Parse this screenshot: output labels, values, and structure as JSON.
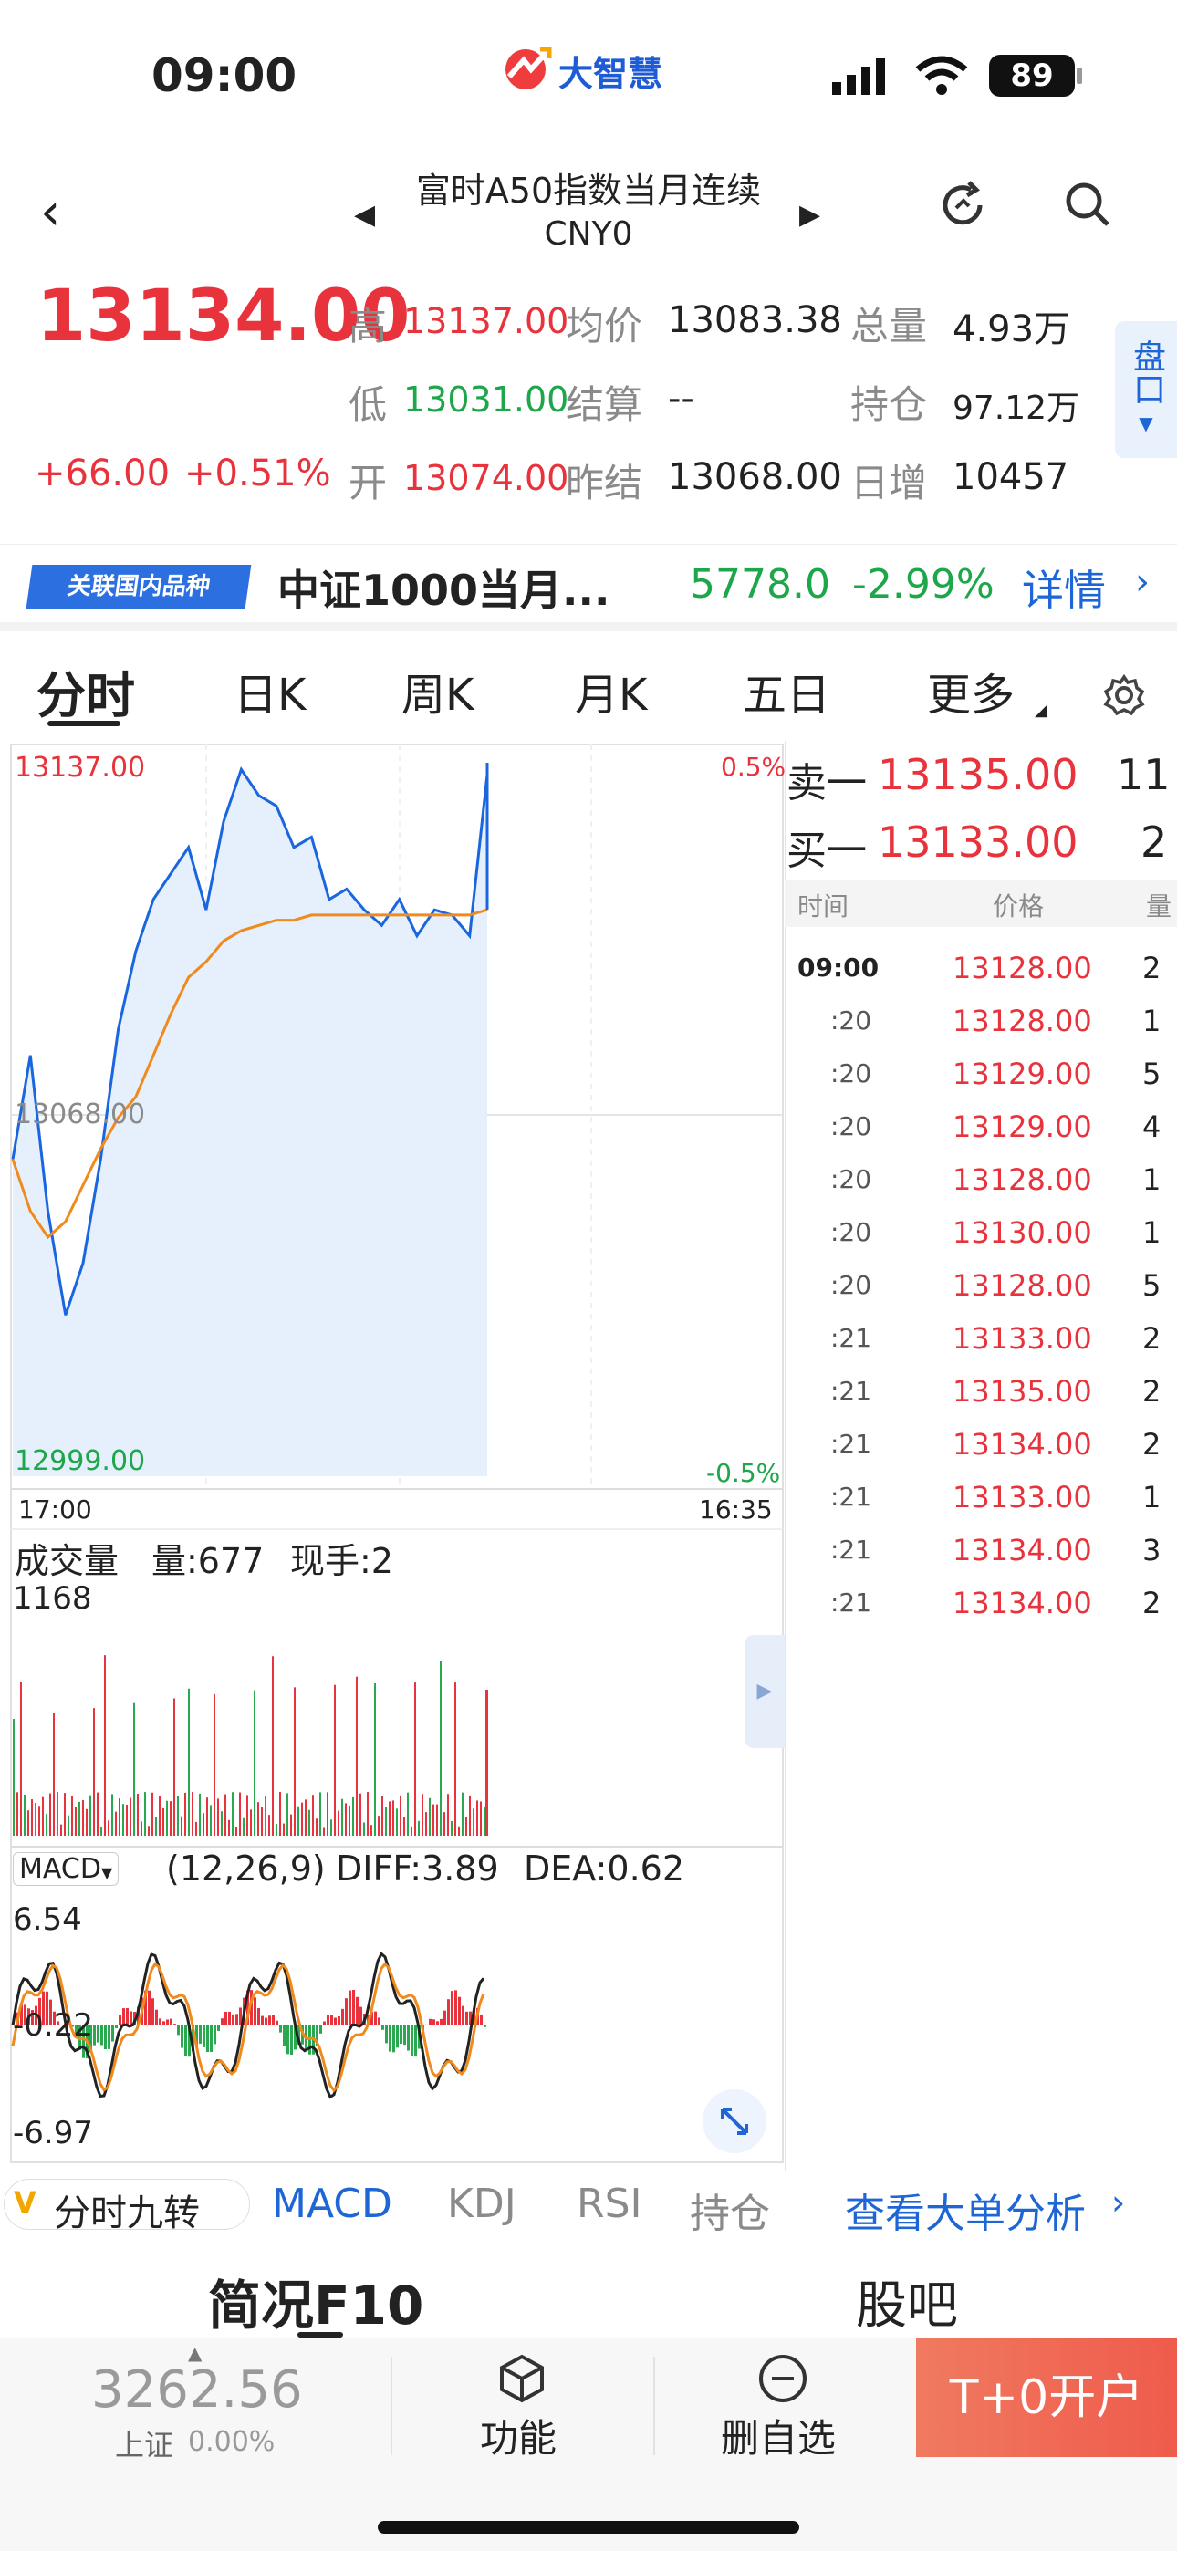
{
  "status": {
    "time": "09:00",
    "app_logo": "大智慧",
    "battery": "89"
  },
  "nav": {
    "title": "富时A50指数当月连续",
    "code": "CNY0"
  },
  "quote": {
    "price": "13134.00",
    "change": "+66.00",
    "change_pct": "+0.51%",
    "high_label": "高",
    "high": "13137.00",
    "avg_label": "均价",
    "avg": "13083.38",
    "vol_label": "总量",
    "vol": "4.93万",
    "low_label": "低",
    "low": "13031.00",
    "settle_label": "结算",
    "settle": "--",
    "oi_label": "持仓",
    "oi": "97.12万",
    "open_label": "开",
    "open": "13074.00",
    "prev_label": "昨结",
    "prev": "13068.00",
    "inc_label": "日增",
    "inc": "10457",
    "side_label": "盘口"
  },
  "related": {
    "tag": "关联国内品种",
    "name": "中证1000当月...",
    "price": "5778.0",
    "pct": "-2.99%",
    "detail": "详情"
  },
  "tabs": [
    "分时",
    "日K",
    "周K",
    "月K",
    "五日",
    "更多"
  ],
  "chart": {
    "top_price": "13137.00",
    "top_pct": "0.5%",
    "mid_price": "13068.00",
    "bottom_price": "12999.00",
    "bottom_pct": "-0.5%",
    "time_start": "17:00",
    "time_end": "16:35",
    "vol_title": "成交量",
    "vol_info": "量:677",
    "vol_hand": "现手:2",
    "vol_max": "1168",
    "macd_label": "MACD",
    "macd_params": "(12,26,9)",
    "diff": "DIFF:3.89",
    "dea": "DEA:0.62",
    "macd_max": "6.54",
    "macd_mid": "-0.22",
    "macd_min": "-6.97"
  },
  "chart_data": {
    "type": "line",
    "series": [
      {
        "values": [
          13060,
          13080,
          13050,
          13030,
          13040,
          13060,
          13085,
          13100,
          13110,
          13115,
          13120,
          13108,
          13125,
          13135,
          13130,
          13128,
          13120,
          13122,
          13110,
          13112,
          13108,
          13105,
          13110,
          13103,
          13108,
          13107,
          13103,
          13134
        ]
      },
      {
        "values": [
          13060,
          13050,
          13045,
          13048,
          13055,
          13062,
          13068,
          13072,
          13080,
          13088,
          13095,
          13098,
          13102,
          13104,
          13105,
          13106,
          13106,
          13107,
          13107,
          13107,
          13107,
          13107,
          13107,
          13107,
          13107,
          13107,
          13107,
          13108
        ]
      }
    ],
    "ylim": [
      12999,
      13137
    ]
  },
  "orderbook": {
    "sell_label": "卖一",
    "sell_price": "13135.00",
    "sell_qty": "11",
    "buy_label": "买一",
    "buy_price": "13133.00",
    "buy_qty": "2",
    "head_time": "时间",
    "head_price": "价格",
    "head_qty": "量",
    "ticks": [
      [
        "09:00",
        "13128.00",
        "2"
      ],
      [
        ":20",
        "13128.00",
        "1"
      ],
      [
        ":20",
        "13129.00",
        "5"
      ],
      [
        ":20",
        "13129.00",
        "4"
      ],
      [
        ":20",
        "13128.00",
        "1"
      ],
      [
        ":20",
        "13130.00",
        "1"
      ],
      [
        ":20",
        "13128.00",
        "5"
      ],
      [
        ":21",
        "13133.00",
        "2"
      ],
      [
        ":21",
        "13135.00",
        "2"
      ],
      [
        ":21",
        "13134.00",
        "2"
      ],
      [
        ":21",
        "13133.00",
        "1"
      ],
      [
        ":21",
        "13134.00",
        "3"
      ],
      [
        ":21",
        "13134.00",
        "2"
      ]
    ]
  },
  "indicators": {
    "nine": "分时九转",
    "items": [
      "MACD",
      "KDJ",
      "RSI",
      "持仓"
    ],
    "big_order": "查看大单分析"
  },
  "sub_tabs": {
    "f10": "简况F10",
    "bar": "股吧"
  },
  "bottom": {
    "index_value": "3262.56",
    "index_name": "上证",
    "index_pct": "0.00%",
    "func": "功能",
    "del": "删自选",
    "open": "T+0开户"
  }
}
